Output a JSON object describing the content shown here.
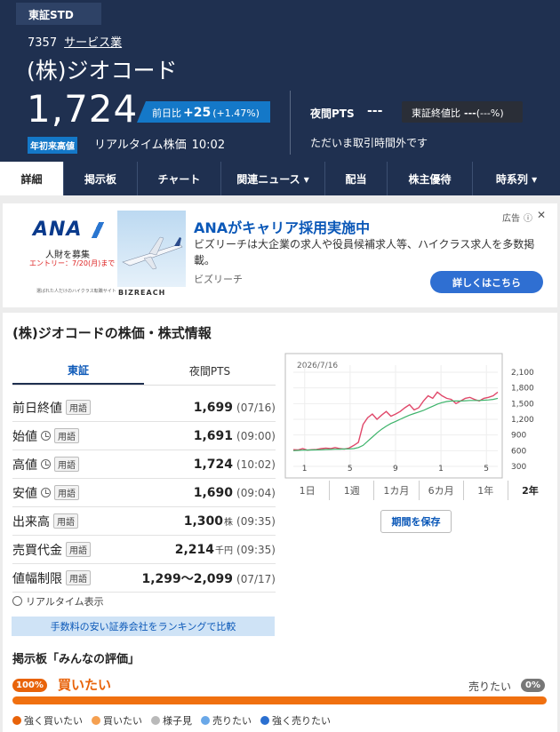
{
  "header": {
    "market_tab": "東証STD",
    "code": "7357",
    "sector": "サービス業",
    "company": "(株)ジオコード",
    "price": "1,724",
    "change_label": "前日比",
    "change_value": "+25",
    "change_pct": "(+1.47%)",
    "ytd_badge": "年初来高値",
    "realtime_label": "リアルタイム株価",
    "realtime_time": "10:02",
    "pts_label": "夜間PTS",
    "pts_value": "---",
    "ratio_label": "東証終値比",
    "ratio_value": "---",
    "ratio_pct": "(---%)",
    "closed_msg": "ただいま取引時間外です"
  },
  "tabs": [
    {
      "label": "詳細",
      "active": true
    },
    {
      "label": "掲示板"
    },
    {
      "label": "チャート"
    },
    {
      "label": "関連ニュース ▾"
    },
    {
      "label": "配当"
    },
    {
      "label": "株主優待"
    },
    {
      "label": "時系列 ▾"
    }
  ],
  "ad": {
    "logo": "ANA",
    "recruit": "人財を募集",
    "entry": "エントリー：7/20(月)まで",
    "small": "選ばれた人だけのハイクラス転職サイト",
    "brand2": "BIZREACH",
    "title": "ANAがキャリア採用実施中",
    "desc": "ビズリーチは大企業の求人や役員候補求人等、ハイクラス求人を多数掲載。",
    "source": "ビズリーチ",
    "label": "広告",
    "info": "ⓘ",
    "close": "✕",
    "cta": "詳しくはこちら"
  },
  "card": {
    "title": "(株)ジオコードの株価・株式情報",
    "sub_tabs": [
      "東証",
      "夜間PTS"
    ],
    "rows": [
      {
        "label": "前日終値",
        "clock": false,
        "tag": "用語",
        "value": "1,699",
        "unit": "",
        "date": "(07/16)"
      },
      {
        "label": "始値",
        "clock": true,
        "tag": "用語",
        "value": "1,691",
        "unit": "",
        "date": "(09:00)"
      },
      {
        "label": "高値",
        "clock": true,
        "tag": "用語",
        "value": "1,724",
        "unit": "",
        "date": "(10:02)"
      },
      {
        "label": "安値",
        "clock": true,
        "tag": "用語",
        "value": "1,690",
        "unit": "",
        "date": "(09:04)"
      },
      {
        "label": "出来高",
        "clock": false,
        "tag": "用語",
        "value": "1,300",
        "unit": "株",
        "date": "(09:35)"
      },
      {
        "label": "売買代金",
        "clock": false,
        "tag": "用語",
        "value": "2,214",
        "unit": "千円",
        "date": "(09:35)"
      },
      {
        "label": "値幅制限",
        "clock": false,
        "tag": "用語",
        "value": "1,299～2,099",
        "unit": "",
        "date": "(07/17)"
      }
    ],
    "rt_note": "リアルタイム表示",
    "compare_btn": "手数料の安い証券会社をランキングで比較",
    "save_btn": "期間を保存"
  },
  "chart_data": {
    "type": "line",
    "date_label": "2026/7/16",
    "x_ticks": [
      "1",
      "5",
      "9",
      "1",
      "5"
    ],
    "y_ticks": [
      "2,100",
      "1,800",
      "1,500",
      "1,200",
      "900",
      "600",
      "300"
    ],
    "ylim": [
      300,
      2100
    ],
    "series": [
      {
        "values": [
          620,
          615,
          640,
          610,
          620,
          625,
          640,
          650,
          640,
          660,
          640,
          630,
          650,
          700,
          760,
          1100,
          1230,
          1300,
          1200,
          1280,
          1350,
          1260,
          1300,
          1350,
          1420,
          1480,
          1380,
          1420,
          1550,
          1650,
          1600,
          1720,
          1650,
          1600,
          1580,
          1500,
          1550,
          1600,
          1620,
          1580,
          1550,
          1600,
          1620,
          1650,
          1720
        ]
      },
      {
        "values": [
          600,
          605,
          610,
          612,
          614,
          616,
          618,
          622,
          625,
          628,
          630,
          632,
          634,
          640,
          660,
          700,
          780,
          860,
          940,
          1010,
          1070,
          1120,
          1160,
          1200,
          1240,
          1280,
          1310,
          1340,
          1370,
          1410,
          1450,
          1490,
          1520,
          1540,
          1550,
          1550,
          1550,
          1555,
          1560,
          1560,
          1560,
          1565,
          1570,
          1580,
          1600
        ]
      }
    ],
    "series_colors": [
      "#e0486a",
      "#3cb36a"
    ],
    "periods": [
      "1日",
      "1週",
      "1カ月",
      "6カ月",
      "1年",
      "2年"
    ],
    "active_period": "2年"
  },
  "sentiment": {
    "title": "掲示板「みんなの評価」",
    "buy_pct": "100%",
    "buy_label": "買いたい",
    "sell_label": "売りたい",
    "sell_pct": "0%",
    "buy_fraction": 1.0,
    "legend": [
      {
        "label": "強く買いたい",
        "color": "#e8630a"
      },
      {
        "label": "買いたい",
        "color": "#f5a050"
      },
      {
        "label": "様子見",
        "color": "#b9b9b9"
      },
      {
        "label": "売りたい",
        "color": "#6aa8e8"
      },
      {
        "label": "強く売りたい",
        "color": "#2a6fd0"
      }
    ]
  }
}
